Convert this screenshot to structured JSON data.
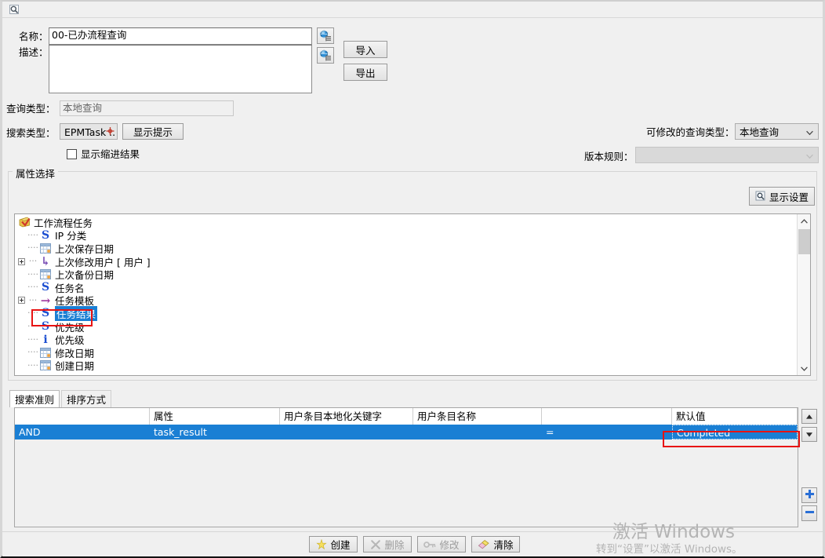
{
  "window": {
    "title_icon": "query-search-icon"
  },
  "form": {
    "name_label": "名称：",
    "name_value": "00-已办流程查询",
    "desc_label": "描述：",
    "desc_value": "",
    "locale_icon": "globe-locale-icon",
    "import_label": "导入",
    "export_label": "导出",
    "query_type_label": "查询类型：",
    "query_type_value": "本地查询",
    "search_type_label": "搜索类型：",
    "search_type_value": "EPMTask ..",
    "show_hint_label": "显示提示",
    "show_indent_label": "显示缩进结果",
    "modifiable_query_type_label": "可修改的查询类型：",
    "modifiable_query_type_value": "本地查询",
    "version_rule_label": "版本规则：",
    "version_rule_value": ""
  },
  "attribute_panel": {
    "title": "属性选择",
    "display_settings_label": "显示设置",
    "display_settings_icon": "magnifier-settings-icon",
    "tree": [
      {
        "label": "工作流程任务",
        "icon": "workflow-task-icon",
        "icon_glyph": "",
        "icon_color": "#d4462a",
        "depth": 0,
        "expander": "none",
        "selected": false
      },
      {
        "label": "IP 分类",
        "icon": "string-attr-icon",
        "icon_glyph": "S",
        "icon_color": "#1d4fd1",
        "depth": 1,
        "expander": "none",
        "selected": false
      },
      {
        "label": "上次保存日期",
        "icon": "date-attr-icon",
        "icon_glyph": "",
        "icon_color": "#6f9fd8",
        "depth": 1,
        "expander": "none",
        "selected": false
      },
      {
        "label": "上次修改用户 [ 用户 ]",
        "icon": "reference-attr-icon",
        "icon_glyph": "↳",
        "icon_color": "#7a4fb5",
        "depth": 1,
        "expander": "plus",
        "selected": false
      },
      {
        "label": "上次备份日期",
        "icon": "date-attr-icon",
        "icon_glyph": "",
        "icon_color": "#6f9fd8",
        "depth": 1,
        "expander": "none",
        "selected": false
      },
      {
        "label": "任务名",
        "icon": "string-attr-icon",
        "icon_glyph": "S",
        "icon_color": "#1d4fd1",
        "depth": 1,
        "expander": "none",
        "selected": false
      },
      {
        "label": "任务模板",
        "icon": "link-attr-icon",
        "icon_glyph": "→",
        "icon_color": "#a0389e",
        "depth": 1,
        "expander": "plus",
        "selected": false
      },
      {
        "label": "任务结果",
        "icon": "string-attr-icon",
        "icon_glyph": "S",
        "icon_color": "#1d4fd1",
        "depth": 1,
        "expander": "none",
        "selected": true
      },
      {
        "label": "优先级",
        "icon": "string-attr-icon",
        "icon_glyph": "S",
        "icon_color": "#1d4fd1",
        "depth": 1,
        "expander": "none",
        "selected": false
      },
      {
        "label": "优先级",
        "icon": "integer-attr-icon",
        "icon_glyph": "i",
        "icon_color": "#1d4fd1",
        "depth": 1,
        "expander": "none",
        "selected": false
      },
      {
        "label": "修改日期",
        "icon": "date-attr-icon",
        "icon_glyph": "",
        "icon_color": "#6f9fd8",
        "depth": 1,
        "expander": "none",
        "selected": false
      },
      {
        "label": "创建日期",
        "icon": "date-attr-icon",
        "icon_glyph": "",
        "icon_color": "#6f9fd8",
        "depth": 1,
        "expander": "none",
        "selected": false
      }
    ],
    "scrollbar": {
      "up_arrow": "chevron-up-icon",
      "down_arrow": "chevron-down-icon"
    }
  },
  "criteria_panel": {
    "tabs": [
      {
        "label": "搜索准则",
        "active": true
      },
      {
        "label": "排序方式",
        "active": false
      }
    ],
    "columns": [
      "",
      "属性",
      "用户条目本地化关键字",
      "用户条目名称",
      "",
      "默认值"
    ],
    "rows": [
      {
        "cells": [
          "AND",
          "task_result",
          "",
          "",
          "=",
          "Completed"
        ],
        "selected": true,
        "focused_cell_index": 5
      }
    ],
    "scroll_up_icon": "scroll-up-icon",
    "scroll_down_icon": "scroll-down-icon",
    "add_row_icon": "plus-icon",
    "remove_row_icon": "minus-icon"
  },
  "footer": {
    "buttons": [
      {
        "label": "创建",
        "icon": "new-star-icon",
        "enabled": true
      },
      {
        "label": "删除",
        "icon": "x-delete-icon",
        "enabled": false
      },
      {
        "label": "修改",
        "icon": "key-modify-icon",
        "enabled": false
      },
      {
        "label": "清除",
        "icon": "eraser-clear-icon",
        "enabled": true
      }
    ]
  },
  "watermark": {
    "title": "激活 Windows",
    "subtitle": "转到“设置”以激活 Windows。"
  },
  "colors": {
    "selection_blue": "#1a7fd4",
    "annotation_red": "#e81313",
    "window_bg": "#f0f0f0"
  }
}
